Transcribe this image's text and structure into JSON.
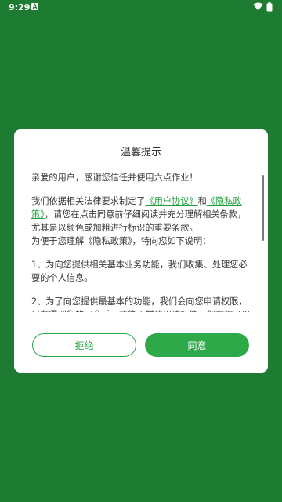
{
  "status_bar": {
    "time": "9:29",
    "icons": [
      "notification-a-icon",
      "wifi-icon",
      "battery-icon"
    ]
  },
  "dialog": {
    "title": "温馨提示",
    "greeting": "亲爱的用户，感谢您信任并使用六点作业！",
    "para2_pre": "我们依据相关法律要求制定了",
    "user_agreement_link": "《用户协议》",
    "para2_and": "和",
    "privacy_policy_link": "《隐私政策》",
    "para2_post": "，请您在点击同意前仔细阅读并充分理解相关条款，尤其是以颜色或加粗进行标识的重要条款。",
    "para2_line2": "为便于您理解《隐私政策》，特向您如下说明：",
    "point1": "1、为向您提供相关基本业务功能，我们收集、处理您必要的个人信息。",
    "point2": "2、为了向您提供最基本的功能，我们会向您申请权限，只有得到您的同意后，才能正常使用该功能。您有权了以",
    "refuse_button": "拒绝",
    "agree_button": "同意"
  },
  "colors": {
    "background": "#1e7b32",
    "accent": "#2ea94a",
    "link": "#1f9d3b"
  }
}
